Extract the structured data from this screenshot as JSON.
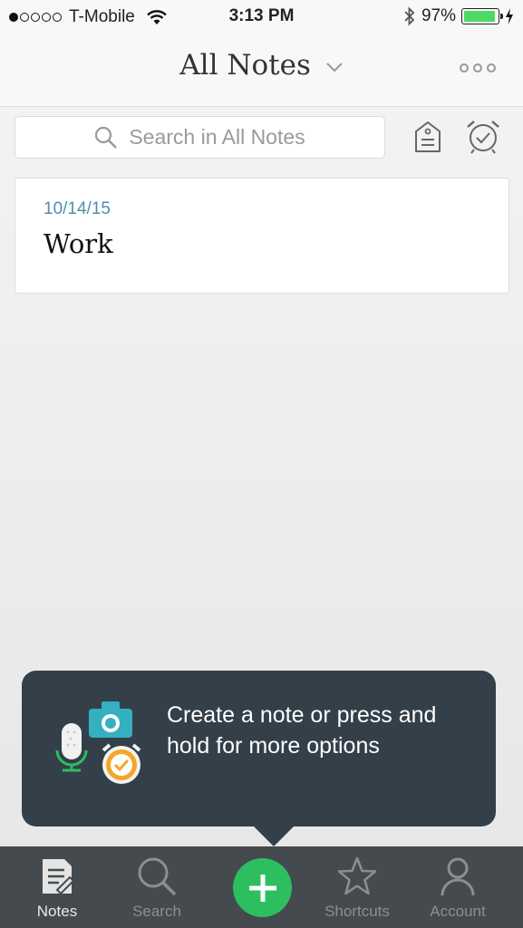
{
  "status_bar": {
    "carrier": "T-Mobile",
    "time": "3:13 PM",
    "battery_percent": "97%",
    "battery_level": 0.97,
    "signal_bars": 1,
    "icons": [
      "wifi-icon",
      "bluetooth-icon",
      "battery-icon",
      "charging-icon"
    ]
  },
  "header": {
    "title": "All Notes",
    "menu_icon": "more-options-icon"
  },
  "search": {
    "placeholder": "Search in All Notes"
  },
  "toolbar_icons": [
    "tag-icon",
    "reminder-alarm-icon"
  ],
  "notes": [
    {
      "date": "10/14/15",
      "title": "Work"
    }
  ],
  "tooltip": {
    "text": "Create a note or press and hold for more options",
    "art_icons": [
      "microphone-icon",
      "camera-icon",
      "alarm-clock-icon"
    ]
  },
  "tab_bar": {
    "tabs": [
      {
        "label": "Notes",
        "icon": "notes-icon",
        "active": true
      },
      {
        "label": "Search",
        "icon": "search-icon",
        "active": false
      },
      {
        "label": "",
        "icon": "add-note-icon",
        "active": false
      },
      {
        "label": "Shortcuts",
        "icon": "star-icon",
        "active": false
      },
      {
        "label": "Account",
        "icon": "account-icon",
        "active": false
      }
    ]
  },
  "colors": {
    "accent_green": "#2dbe60",
    "date_blue": "#4e8fb0",
    "tooltip_bg": "#33404a",
    "tab_bar_bg": "#444a4e"
  }
}
